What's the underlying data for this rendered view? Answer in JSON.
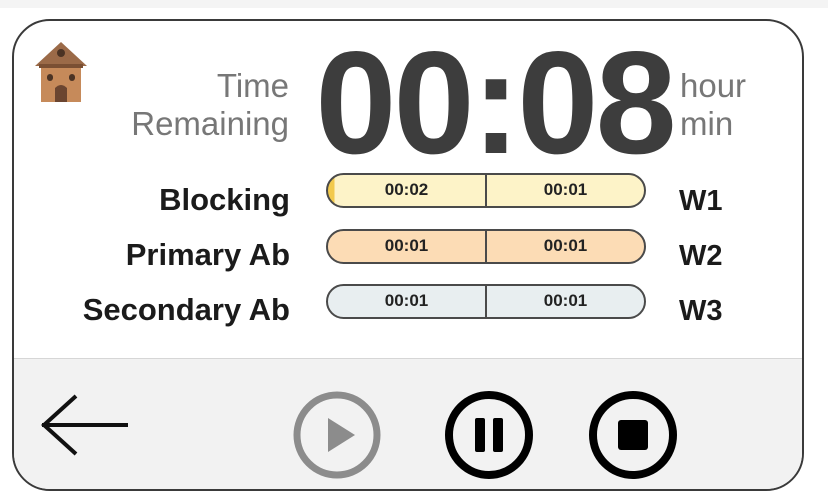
{
  "header": {
    "time_remaining_line1": "Time",
    "time_remaining_line2": "Remaining",
    "clock": "00:08",
    "unit_line1": "hour",
    "unit_line2": "min"
  },
  "rows": [
    {
      "label": "Blocking",
      "seg_a": "00:02",
      "seg_b": "00:01",
      "tag": "W1",
      "color": "#fdf3c8",
      "progress": 0.02
    },
    {
      "label": "Primary Ab",
      "seg_a": "00:01",
      "seg_b": "00:01",
      "tag": "W2",
      "color": "#fcdcb5",
      "progress": 0
    },
    {
      "label": "Secondary Ab",
      "seg_a": "00:01",
      "seg_b": "00:01",
      "tag": "W3",
      "color": "#e8eef0",
      "progress": 0
    }
  ],
  "controls": {
    "back": "back-arrow-icon",
    "play": "play-icon",
    "pause": "pause-icon",
    "stop": "stop-icon",
    "play_enabled": false
  },
  "colors": {
    "house_roof": "#9b6a48",
    "house_body": "#c68a5a"
  }
}
